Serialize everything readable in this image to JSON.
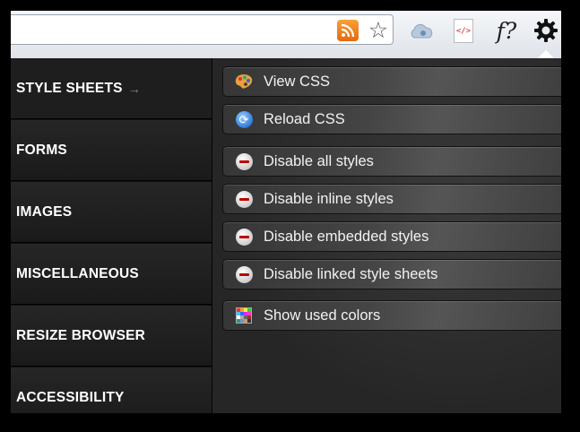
{
  "toolbar": {
    "icons": [
      "rss-feed-icon",
      "bookmark-star-icon",
      "cloud-icon",
      "view-source-icon",
      "font-help-icon",
      "settings-gear-icon"
    ],
    "font_help_label": "f?",
    "code_label": "</>",
    "star_glyph": "☆"
  },
  "sidebar": {
    "items": [
      {
        "label": "STYLE SHEETS",
        "arrow": "→",
        "active": true
      },
      {
        "label": "FORMS"
      },
      {
        "label": "IMAGES"
      },
      {
        "label": "MISCELLANEOUS"
      },
      {
        "label": "RESIZE BROWSER"
      },
      {
        "label": "ACCESSIBILITY"
      }
    ]
  },
  "commands": [
    {
      "label": "View CSS",
      "icon": "palette-icon"
    },
    {
      "label": "Reload CSS",
      "icon": "reload-icon"
    },
    {
      "label": "Disable all styles",
      "icon": "disable-icon"
    },
    {
      "label": "Disable inline styles",
      "icon": "disable-icon"
    },
    {
      "label": "Disable embedded styles",
      "icon": "disable-icon"
    },
    {
      "label": "Disable linked style sheets",
      "icon": "disable-icon"
    },
    {
      "label": "Show used colors",
      "icon": "color-grid-icon"
    }
  ],
  "colors": {
    "swatch": [
      "#e33",
      "#f93",
      "#fe3",
      "#3c3",
      "#3cf",
      "#36f",
      "#c3f",
      "#f3c",
      "#fff",
      "#aaa",
      "#666",
      "#933",
      "#396",
      "#69c",
      "#c96",
      "#333"
    ]
  }
}
